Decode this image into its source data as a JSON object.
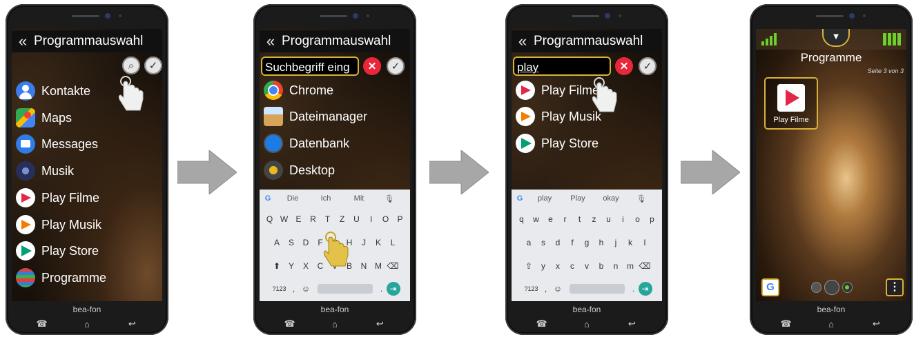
{
  "brand": "bea-fon",
  "phone1": {
    "title": "Programmauswahl",
    "apps": [
      "Kontakte",
      "Maps",
      "Messages",
      "Musik",
      "Play Filme",
      "Play Musik",
      "Play Store",
      "Programme"
    ]
  },
  "phone2": {
    "title": "Programmauswahl",
    "search_placeholder": "Suchbegriff eing",
    "apps": [
      "Chrome",
      "Dateimanager",
      "Datenbank",
      "Desktop"
    ],
    "suggestions": [
      "Die",
      "Ich",
      "Mit"
    ],
    "row1": [
      "Q",
      "W",
      "E",
      "R",
      "T",
      "Z",
      "U",
      "I",
      "O",
      "P"
    ],
    "row2": [
      "A",
      "S",
      "D",
      "F",
      "G",
      "H",
      "J",
      "K",
      "L"
    ],
    "row3": [
      "Y",
      "X",
      "C",
      "V",
      "B",
      "N",
      "M"
    ],
    "sym": "?123"
  },
  "phone3": {
    "title": "Programmauswahl",
    "search_value": "play",
    "apps": [
      "Play Filme",
      "Play Musik",
      "Play Store"
    ],
    "suggestions": [
      "play",
      "Play",
      "okay"
    ],
    "row1": [
      "q",
      "w",
      "e",
      "r",
      "t",
      "z",
      "u",
      "i",
      "o",
      "p"
    ],
    "row2": [
      "a",
      "s",
      "d",
      "f",
      "g",
      "h",
      "j",
      "k",
      "l"
    ],
    "row3": [
      "y",
      "x",
      "c",
      "v",
      "b",
      "n",
      "m"
    ],
    "sym": "?123"
  },
  "phone4": {
    "title": "Programme",
    "page": "Seite 3 von 3",
    "tile_label": "Play Filme",
    "google_letter": "G"
  },
  "colors": {
    "accent": "#d8b23a",
    "red": "#e8283a",
    "signal": "#6ccf2a"
  }
}
